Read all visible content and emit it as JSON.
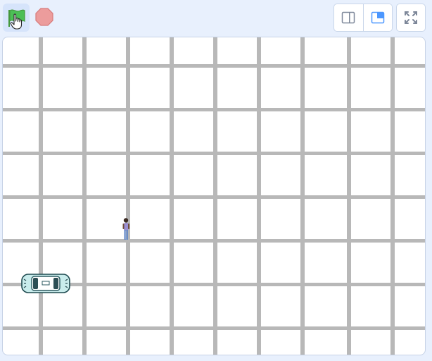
{
  "toolbar": {
    "green_flag": {
      "icon": "green-flag-icon",
      "color": "#4cbf56"
    },
    "stop": {
      "icon": "stop-sign-icon",
      "color": "#ec9c9c"
    },
    "layout_buttons": [
      {
        "icon": "small-stage-icon"
      },
      {
        "icon": "normal-stage-icon",
        "accent": "#4c97ff"
      }
    ],
    "fullscreen": {
      "icon": "fullscreen-icon"
    }
  },
  "stage": {
    "background": "#ffffff",
    "grid_line_color": "#b8b8b8",
    "sprites": [
      {
        "name": "person-sprite",
        "shirt_color": "#9b8fd1"
      },
      {
        "name": "car-sprite",
        "color": "#c9ecec"
      }
    ]
  }
}
